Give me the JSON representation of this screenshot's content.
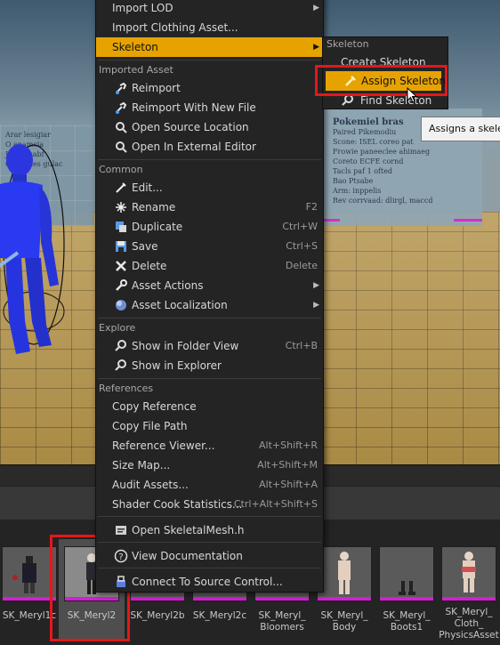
{
  "viewport": {
    "wall_right_title": "Pokemiel bras",
    "wall_right_lines": [
      "Paired Pikemodiu",
      "Scone: ISEL coreo pat",
      "Frowie paneeclee ahimaeg",
      "Coreto ECFE cornd",
      "Tacls paf 1 ofted",
      "Bao Ptsabe",
      "Arm: inppelis",
      "Rev corrvaad: dlirgl, maccd"
    ],
    "wall_left_lines": [
      "Arar lesigiar",
      "O enamcia",
      "Jipnir, sabf",
      "Coll abies gulac"
    ]
  },
  "content_browser": {
    "tiles": [
      {
        "label": "SK_Meryl1c"
      },
      {
        "label": "SK_Meryl2"
      },
      {
        "label": "SK_Meryl2b"
      },
      {
        "label": "SK_Meryl2c"
      },
      {
        "label": "SK_Meryl_\nBloomers"
      },
      {
        "label": "SK_Meryl_\nBody"
      },
      {
        "label": "SK_Meryl_\nBoots1"
      },
      {
        "label": "SK_Meryl_\nCloth_\nPhysicsAsset"
      }
    ]
  },
  "menu": {
    "top_items": [
      {
        "label": "Import LOD",
        "arrow": "▶"
      },
      {
        "label": "Import Clothing Asset..."
      },
      {
        "label": "Skeleton",
        "arrow": "▶"
      }
    ],
    "sections": {
      "imported_asset": "Imported Asset",
      "common": "Common",
      "explore": "Explore",
      "references": "References"
    },
    "imported_asset": [
      {
        "label": "Reimport"
      },
      {
        "label": "Reimport With New File"
      },
      {
        "label": "Open Source Location"
      },
      {
        "label": "Open In External Editor"
      }
    ],
    "common": [
      {
        "label": "Edit...",
        "shortcut": ""
      },
      {
        "label": "Rename",
        "shortcut": "F2"
      },
      {
        "label": "Duplicate",
        "shortcut": "Ctrl+W"
      },
      {
        "label": "Save",
        "shortcut": "Ctrl+S"
      },
      {
        "label": "Delete",
        "shortcut": "Delete"
      },
      {
        "label": "Asset Actions",
        "arrow": "▶"
      },
      {
        "label": "Asset Localization",
        "arrow": "▶"
      }
    ],
    "explore": [
      {
        "label": "Show in Folder View",
        "shortcut": "Ctrl+B"
      },
      {
        "label": "Show in Explorer",
        "shortcut": ""
      }
    ],
    "references": [
      {
        "label": "Copy Reference",
        "shortcut": ""
      },
      {
        "label": "Copy File Path",
        "shortcut": ""
      },
      {
        "label": "Reference Viewer...",
        "shortcut": "Alt+Shift+R"
      },
      {
        "label": "Size Map...",
        "shortcut": "Alt+Shift+M"
      },
      {
        "label": "Audit Assets...",
        "shortcut": "Alt+Shift+A"
      },
      {
        "label": "Shader Cook Statistics...",
        "shortcut": "Ctrl+Alt+Shift+S"
      }
    ],
    "bottom": [
      {
        "label": "Open SkeletalMesh.h"
      },
      {
        "label": "View Documentation"
      },
      {
        "label": "Connect To Source Control..."
      }
    ]
  },
  "submenu": {
    "section": "Skeleton",
    "items": [
      {
        "label": "Create Skeleton"
      },
      {
        "label": "Assign Skeleton"
      },
      {
        "label": "Find Skeleton"
      }
    ]
  },
  "tooltip": "Assigns a skeleton",
  "colors": {
    "highlight": "#e6a300",
    "annotation": "#e5171b",
    "accent_strip": "#d21fd2"
  }
}
